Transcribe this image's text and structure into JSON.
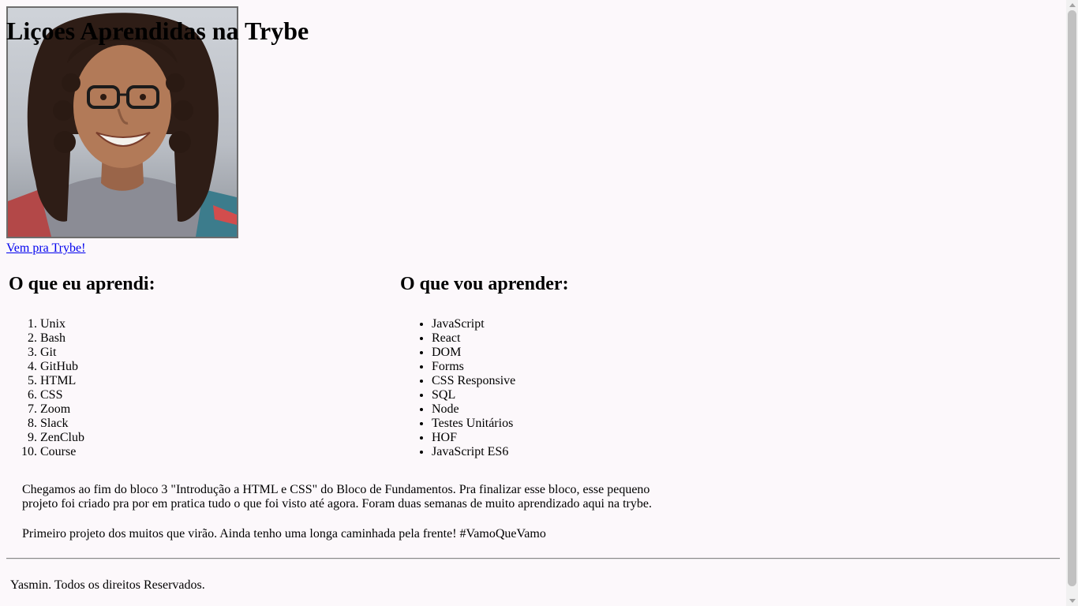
{
  "header": {
    "title": "Liçoes Aprendidas na Trybe",
    "profile_image": "profile-photo-woman-with-glasses"
  },
  "link": {
    "label": "Vem pra Trybe!"
  },
  "learned": {
    "heading": "O que eu aprendi:",
    "items": [
      "Unix",
      "Bash",
      "Git",
      "GitHub",
      "HTML",
      "CSS",
      "Zoom",
      "Slack",
      "ZenClub",
      "Course"
    ]
  },
  "to_learn": {
    "heading": "O que vou aprender:",
    "items": [
      "JavaScript",
      "React",
      "DOM",
      "Forms",
      "CSS Responsive",
      "SQL",
      "Node",
      "Testes Unitários",
      "HOF",
      "JavaScript ES6"
    ]
  },
  "text": {
    "paragraph1": "Chegamos ao fim do bloco 3 \"Introdução a HTML e CSS\" do Bloco de Fundamentos. Pra finalizar esse bloco, esse pequeno projeto foi criado pra por em pratica tudo o que foi visto até agora. Foram duas semanas de muito aprendizado aqui na trybe.",
    "paragraph2": "Primeiro projeto dos muitos que virão. Ainda tenho uma longa caminhada pela frente! #VamoQueVamo"
  },
  "footer": {
    "text": "Yasmin. Todos os direitos Reservados."
  },
  "colors": {
    "background": "#fcf8fb",
    "link": "#0000ee",
    "border": "#6d6d6d"
  }
}
